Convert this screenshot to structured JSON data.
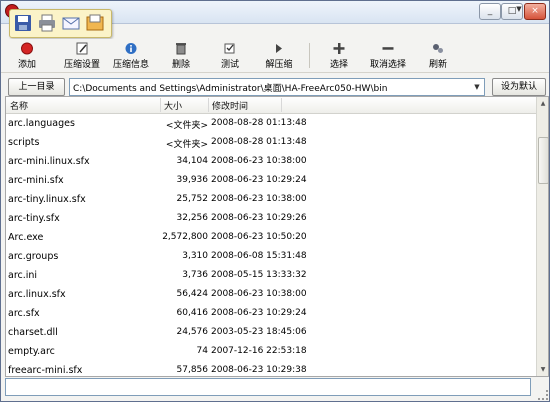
{
  "toolbar": {
    "add": "添加",
    "compress_settings": "压缩设置",
    "compress_info": "压缩信息",
    "delete": "删除",
    "extract": "解压缩",
    "test": "测试",
    "select": "选择",
    "deselect": "取消选择",
    "refresh": "刷新"
  },
  "navigation": {
    "up_button": "上一目录",
    "path": "C:\\Documents and Settings\\Administrator\\桌面\\HA-FreeArc050-HW\\bin",
    "default_button": "设为默认"
  },
  "columns": {
    "name": "名称",
    "size": "大小",
    "modified": "修改时间"
  },
  "files": [
    {
      "name": "arc.languages",
      "size": "<文件夹>",
      "modified": "2008-08-28 01:13:48"
    },
    {
      "name": "scripts",
      "size": "<文件夹>",
      "modified": "2008-08-28 01:13:48"
    },
    {
      "name": "arc-mini.linux.sfx",
      "size": "34,104",
      "modified": "2008-06-23 10:38:00"
    },
    {
      "name": "arc-mini.sfx",
      "size": "39,936",
      "modified": "2008-06-23 10:29:24"
    },
    {
      "name": "arc-tiny.linux.sfx",
      "size": "25,752",
      "modified": "2008-06-23 10:38:00"
    },
    {
      "name": "arc-tiny.sfx",
      "size": "32,256",
      "modified": "2008-06-23 10:29:26"
    },
    {
      "name": "Arc.exe",
      "size": "2,572,800",
      "modified": "2008-06-23 10:50:20"
    },
    {
      "name": "arc.groups",
      "size": "3,310",
      "modified": "2008-06-08 15:31:48"
    },
    {
      "name": "arc.ini",
      "size": "3,736",
      "modified": "2008-05-15 13:33:32"
    },
    {
      "name": "arc.linux.sfx",
      "size": "56,424",
      "modified": "2008-06-23 10:38:00"
    },
    {
      "name": "arc.sfx",
      "size": "60,416",
      "modified": "2008-06-23 10:29:24"
    },
    {
      "name": "charset.dll",
      "size": "24,576",
      "modified": "2003-05-23 18:45:06"
    },
    {
      "name": "empty.arc",
      "size": "74",
      "modified": "2007-12-16 22:53:18"
    },
    {
      "name": "freearc-mini.sfx",
      "size": "57,856",
      "modified": "2008-06-23 10:29:38"
    }
  ],
  "window_controls": {
    "minimize": "_",
    "maximize": "□",
    "close": "×"
  },
  "icons": [
    "save-icon",
    "print-icon",
    "mail-icon",
    "properties-icon",
    "red-dot-icon",
    "edit-page-icon",
    "info-icon",
    "trash-icon",
    "arrow-icon",
    "plus-icon",
    "minus-icon",
    "refresh-icon"
  ],
  "colors": {
    "window_border": "#5f6f8f",
    "qat_background": "#fbf3c8",
    "add_icon": "#d42424"
  }
}
